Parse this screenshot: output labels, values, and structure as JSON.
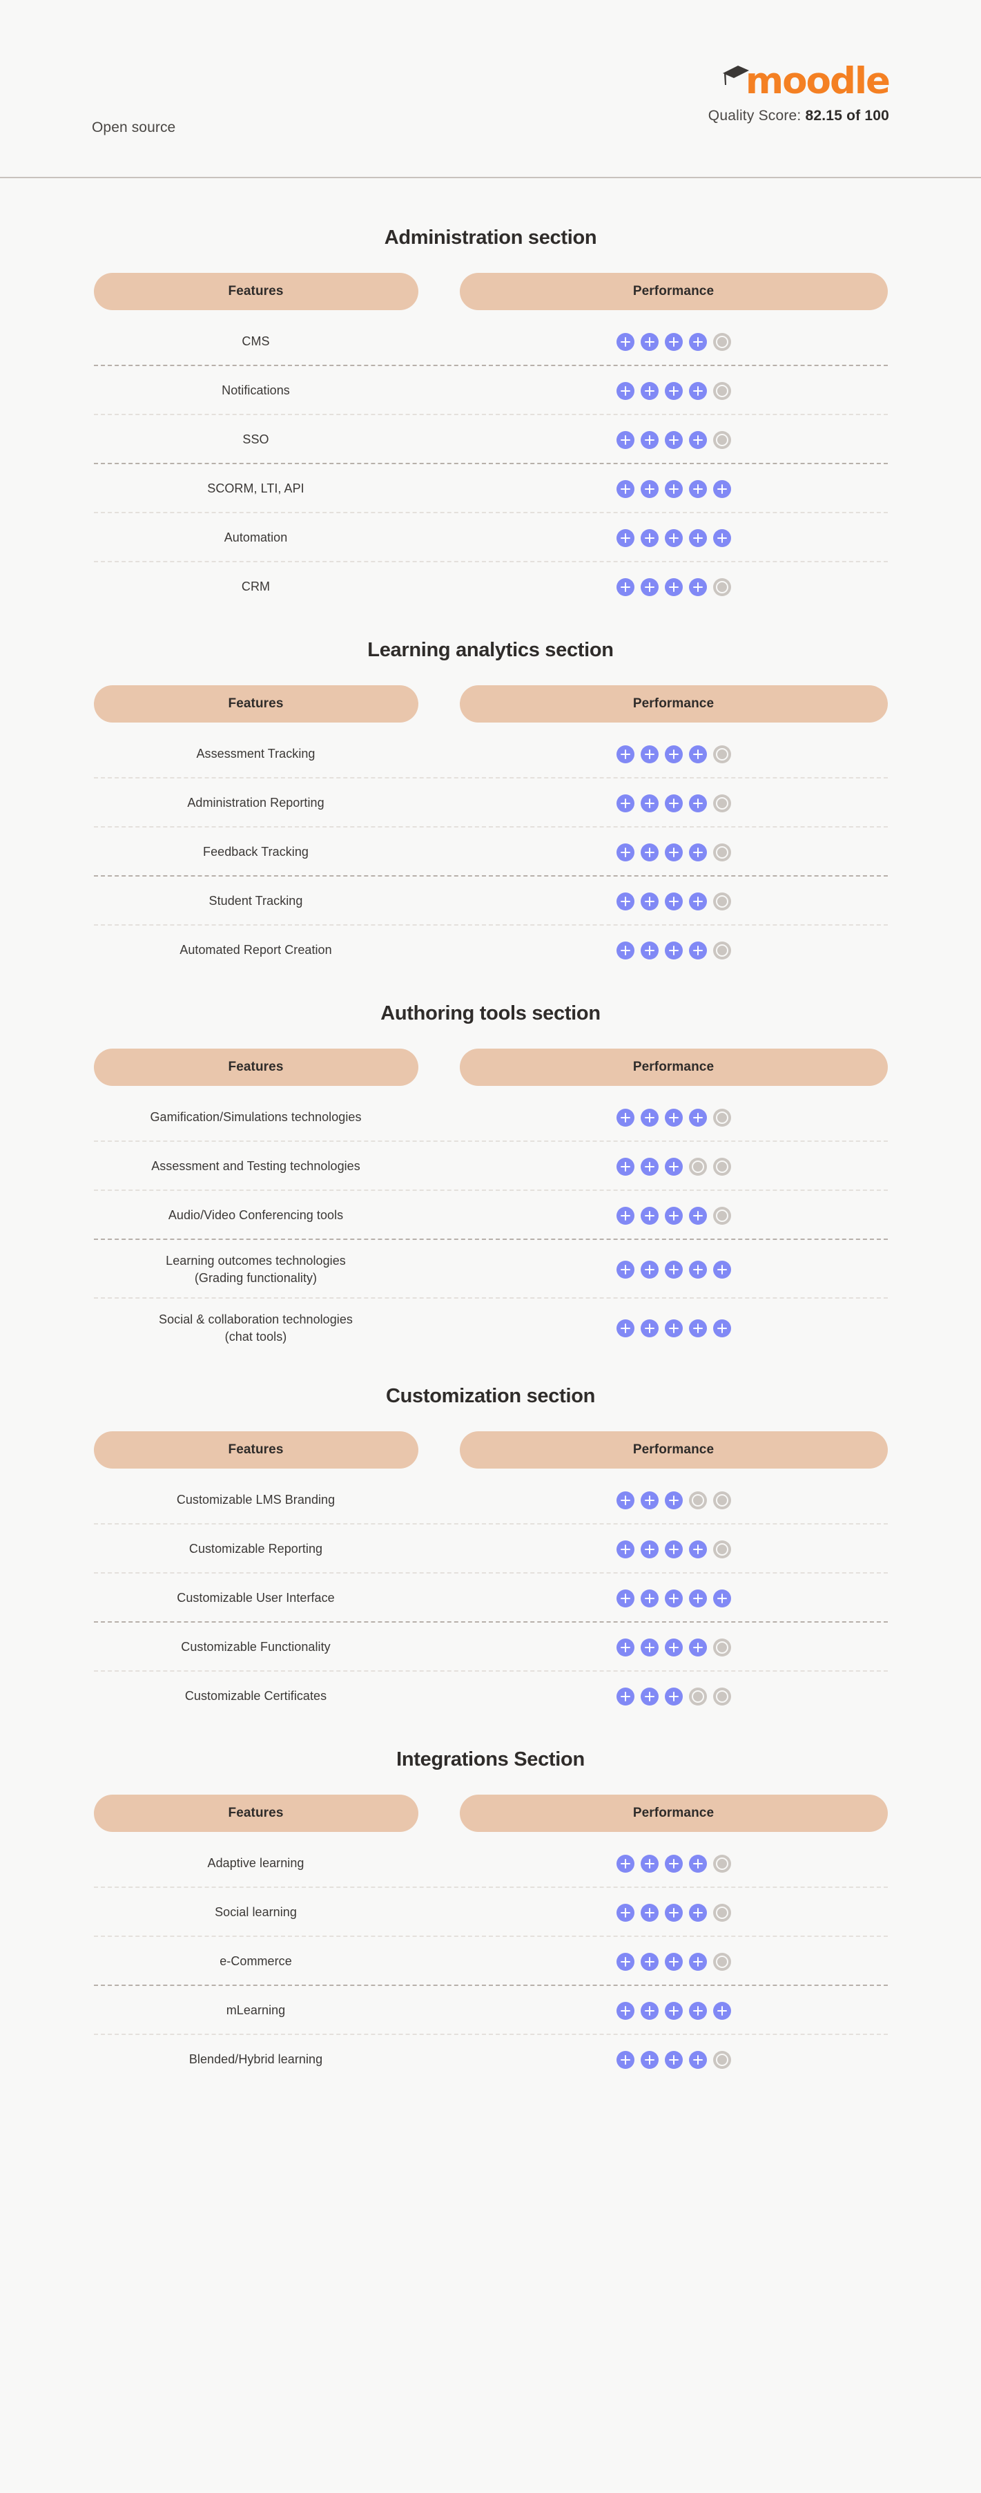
{
  "header": {
    "left_label": "Open source",
    "brand_name": "moodle",
    "brand_color": "#f48023",
    "quality_label": "Quality Score:",
    "quality_value": "82.15 of 100",
    "cap_icon": "graduation-cap-icon"
  },
  "legend": {
    "filled_color": "#8189f5",
    "empty_color": "#cbc6c1",
    "pill_color": "#e9c6ac",
    "max_rating": 5
  },
  "columns": {
    "features": "Features",
    "performance": "Performance"
  },
  "sections": [
    {
      "title": "Administration section",
      "rows": [
        {
          "label": "CMS",
          "rating": 4
        },
        {
          "label": "Notifications",
          "rating": 4
        },
        {
          "label": "SSO",
          "rating": 4
        },
        {
          "label": "SCORM, LTI, API",
          "rating": 5
        },
        {
          "label": "Automation",
          "rating": 5
        },
        {
          "label": "CRM",
          "rating": 4
        }
      ]
    },
    {
      "title": "Learning analytics section",
      "rows": [
        {
          "label": "Assessment Tracking",
          "rating": 4
        },
        {
          "label": "Administration Reporting",
          "rating": 4
        },
        {
          "label": "Feedback Tracking",
          "rating": 4
        },
        {
          "label": "Student Tracking",
          "rating": 4
        },
        {
          "label": "Automated Report Creation",
          "rating": 4
        }
      ]
    },
    {
      "title": "Authoring tools section",
      "rows": [
        {
          "label": "Gamification/Simulations technologies",
          "rating": 4
        },
        {
          "label": "Assessment and Testing technologies",
          "rating": 3
        },
        {
          "label": "Audio/Video Conferencing tools",
          "rating": 4
        },
        {
          "label": "Learning outcomes technologies",
          "label2": "(Grading functionality)",
          "rating": 5
        },
        {
          "label": "Social & collaboration technologies",
          "label2": "(chat tools)",
          "rating": 5
        }
      ]
    },
    {
      "title": "Customization section",
      "rows": [
        {
          "label": "Customizable LMS Branding",
          "rating": 3
        },
        {
          "label": "Customizable Reporting",
          "rating": 4
        },
        {
          "label": "Customizable User Interface",
          "rating": 5
        },
        {
          "label": "Customizable Functionality",
          "rating": 4
        },
        {
          "label": "Customizable Certificates",
          "rating": 3
        }
      ]
    },
    {
      "title": "Integrations Section",
      "rows": [
        {
          "label": "Adaptive learning",
          "rating": 4
        },
        {
          "label": "Social learning",
          "rating": 4
        },
        {
          "label": "e-Commerce",
          "rating": 4
        },
        {
          "label": "mLearning",
          "rating": 5
        },
        {
          "label": "Blended/Hybrid learning",
          "rating": 4
        }
      ]
    }
  ]
}
